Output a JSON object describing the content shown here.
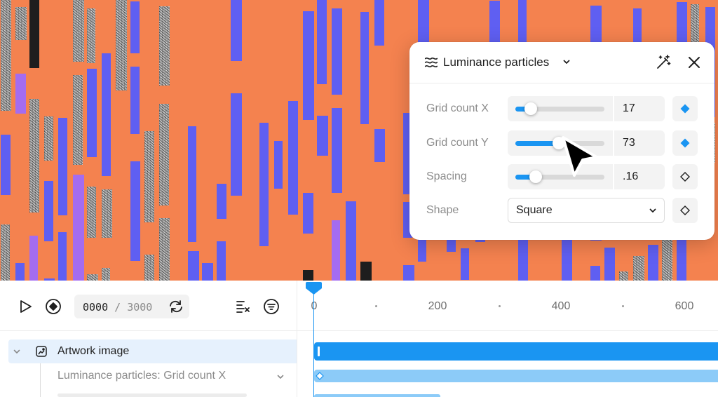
{
  "panel": {
    "title": "Luminance particles",
    "icons": {
      "header": "waves-icon",
      "title_dropdown": "chevron-down-icon",
      "generate": "magic-wand-icon",
      "close": "close-icon"
    },
    "rows": [
      {
        "label": "Grid count X",
        "value": "17",
        "slider_fraction": 0.17,
        "keyframed": true
      },
      {
        "label": "Grid count Y",
        "value": "73",
        "slider_fraction": 0.49,
        "keyframed": true
      },
      {
        "label": "Spacing",
        "value": ".16",
        "slider_fraction": 0.23,
        "keyframed": false
      }
    ],
    "shape": {
      "label": "Shape",
      "value": "Square",
      "keyframed": false
    }
  },
  "timeline": {
    "controls": {
      "play": "play-icon",
      "keyframe": "keyframe-icon",
      "loop": "loop-icon",
      "easing": "easing-icon",
      "filter": "filter-icon"
    },
    "timecode": {
      "current": "0000",
      "separator": " / ",
      "total": "3000"
    },
    "ruler": {
      "labels": [
        "0",
        "200",
        "400",
        "600"
      ]
    },
    "tracks": [
      {
        "name": "Artwork image",
        "icon": "image-layer-icon",
        "expanded": true
      },
      {
        "name": "Luminance particles: Grid count X"
      }
    ]
  },
  "colors": {
    "accent": "#1a95f2",
    "artwork_bg": "#f4824f",
    "artwork_bar": "#5f5ff2"
  }
}
